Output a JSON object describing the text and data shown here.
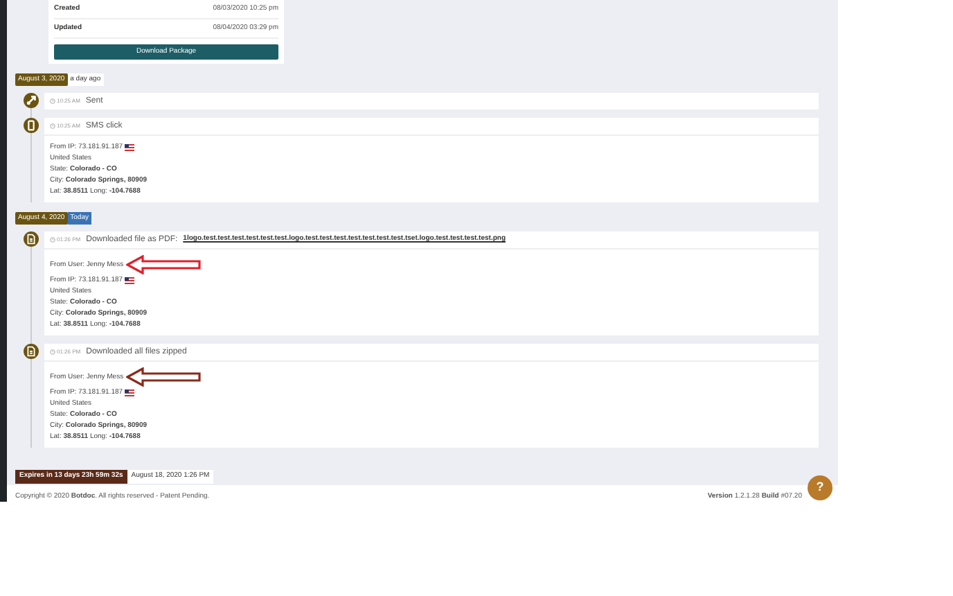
{
  "package": {
    "rows": [
      {
        "label": "Created",
        "value": "08/03/2020 10:25 pm"
      },
      {
        "label": "Updated",
        "value": "08/04/2020 03:29 pm"
      }
    ],
    "button": "Download Package"
  },
  "timeline": [
    {
      "date": "August 3, 2020",
      "relative": "a day ago",
      "relative_highlighted": false,
      "events": [
        {
          "kind": "sent",
          "time": "10:25 AM",
          "title": "Sent"
        },
        {
          "kind": "sms",
          "time": "10:25 AM",
          "title": "SMS click",
          "details": {
            "ip": "From IP: 73.181.91.187",
            "country": "United States",
            "state_label": "State:",
            "state": "Colorado - CO",
            "city_label": "City:",
            "city": "Colorado Springs, 80909",
            "lat_label": "Lat:",
            "lat": "38.8511",
            "long_label": "Long:",
            "long": "-104.7688"
          }
        }
      ]
    },
    {
      "date": "August 4, 2020",
      "relative": "Today",
      "relative_highlighted": true,
      "events": [
        {
          "kind": "download",
          "time": "01:26 PM",
          "title": "Downloaded file as PDF:",
          "file": "1logo.test.test.test.test.test.test.logo.test.test.test.test.test.test.test.tset.logo.test.test.test.test.png",
          "details": {
            "user": "From User: Jenny Mess",
            "annotated": true,
            "ip": "From IP: 73.181.91.187",
            "country": "United States",
            "state_label": "State:",
            "state": "Colorado - CO",
            "city_label": "City:",
            "city": "Colorado Springs, 80909",
            "lat_label": "Lat:",
            "lat": "38.8511",
            "long_label": "Long:",
            "long": "-104.7688"
          }
        },
        {
          "kind": "download",
          "time": "01:26 PM",
          "title": "Downloaded all files zipped",
          "details": {
            "user": "From User: Jenny Mess",
            "annotated": true,
            "ip": "From IP: 73.181.91.187",
            "country": "United States",
            "state_label": "State:",
            "state": "Colorado - CO",
            "city_label": "City:",
            "city": "Colorado Springs, 80909",
            "lat_label": "Lat:",
            "lat": "38.8511",
            "long_label": "Long:",
            "long": "-104.7688"
          }
        }
      ]
    }
  ],
  "expiry": {
    "label": "Expires in",
    "remaining": "13 days 23h 59m 32s",
    "date": "August 18, 2020 1:26 PM"
  },
  "footer": {
    "copyright": "Copyright © 2020 **Botdoc**. All rights reserved - Patent Pending.",
    "version_label": "Version",
    "version": "1.2.1.28",
    "build_label": "Build",
    "build": "#07.20"
  },
  "help": "?"
}
